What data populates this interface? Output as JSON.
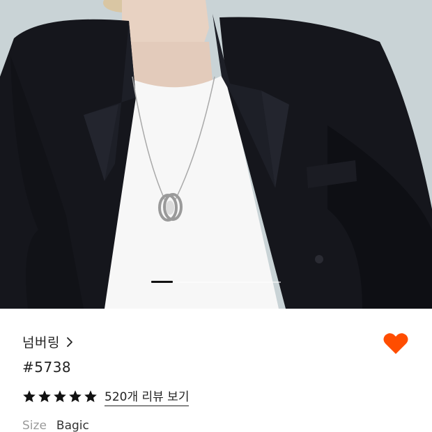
{
  "product": {
    "brand": "넘버링",
    "number": "#5738",
    "rating": 5,
    "rating_max": 5,
    "review_link": "520개 리뷰 보기",
    "size_label": "Size",
    "size_value": "Bagic"
  },
  "gallery": {
    "active_index": 0
  },
  "colors": {
    "heart": "#ff4d00",
    "stars": "#111111",
    "background": "#c9d3d6"
  },
  "icons": {
    "brand_chevron": "chevron-right-icon",
    "wishlist": "heart-icon",
    "rating": "star-icon"
  }
}
